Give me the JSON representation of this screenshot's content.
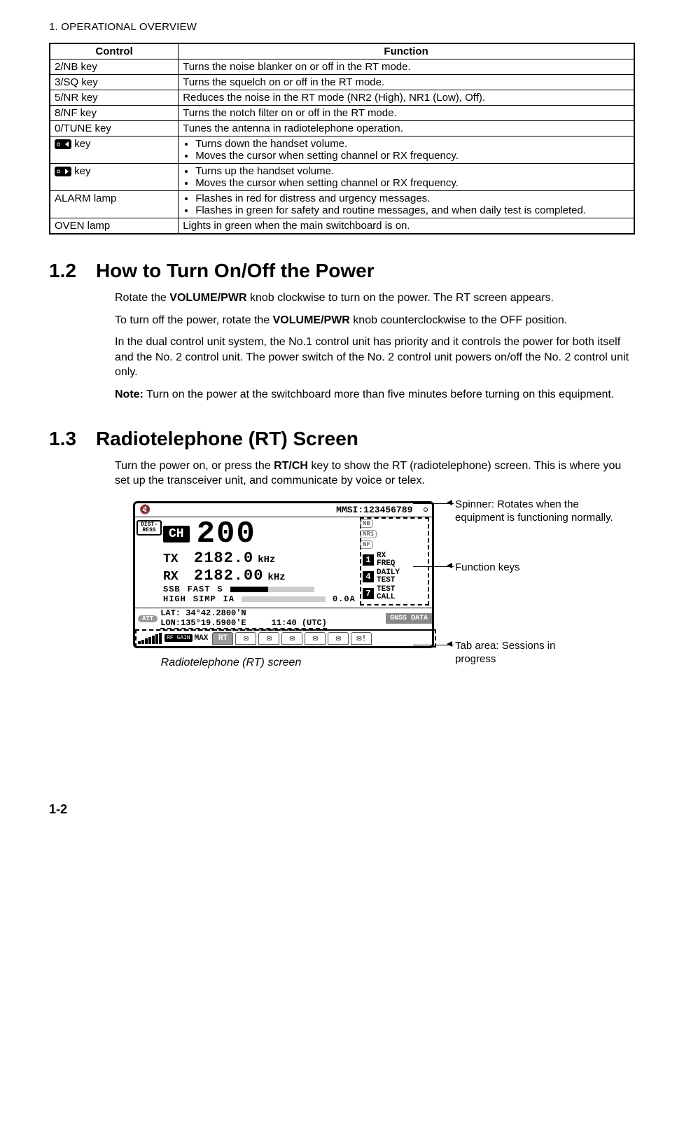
{
  "page_header": "1.  OPERATIONAL OVERVIEW",
  "page_number": "1-2",
  "table": {
    "head": {
      "control": "Control",
      "function": "Function"
    },
    "rows": [
      {
        "control": "2/NB key",
        "function": "Turns the noise blanker on or off in the RT mode."
      },
      {
        "control": "3/SQ key",
        "function": "Turns the squelch on or off in the RT mode."
      },
      {
        "control": "5/NR key",
        "function": "Reduces the noise in the RT mode (NR2 (High), NR1 (Low), Off)."
      },
      {
        "control": "8/NF key",
        "function": "Turns the notch filter on or off in the RT mode."
      },
      {
        "control": "0/TUNE key",
        "function": "Tunes the antenna in radiotelephone operation."
      }
    ],
    "vol_down": {
      "control_suffix": " key",
      "bullets": [
        "Turns down the handset volume.",
        "Moves the cursor when setting channel or RX frequency."
      ]
    },
    "vol_up": {
      "control_suffix": " key",
      "bullets": [
        "Turns up the handset volume.",
        "Moves the cursor when setting channel or RX frequency."
      ]
    },
    "alarm": {
      "control": "ALARM lamp",
      "bullets": [
        "Flashes in red for distress and urgency messages.",
        "Flashes in green for safety and routine messages, and when daily test is completed."
      ]
    },
    "oven": {
      "control": "OVEN lamp",
      "function": "Lights in green when the main switchboard is on."
    }
  },
  "section12": {
    "num": "1.2",
    "title": "How to Turn On/Off the Power",
    "p1a": "Rotate the ",
    "p1b": "VOLUME/PWR",
    "p1c": " knob clockwise to turn on the power. The RT screen appears.",
    "p2a": "To turn off the power, rotate the ",
    "p2b": "VOLUME/PWR",
    "p2c": " knob counterclockwise to the OFF position.",
    "p3": "In the dual control unit system, the No.1 control unit has priority and it controls the power for both itself and the No. 2 control unit. The power switch of the No. 2 control unit powers on/off the No. 2 control unit only.",
    "note_label": "Note:",
    "note_body": " Turn on the power at the switchboard more than five minutes before turning on this equipment."
  },
  "section13": {
    "num": "1.3",
    "title": "Radiotelephone (RT) Screen",
    "p1a": "Turn the power on, or press the ",
    "p1b": "RT/CH",
    "p1c": " key to show the RT (radiotelephone) screen. This is where you set up the transceiver unit, and communicate by voice or telex."
  },
  "rt": {
    "mmsi_label": "MMSI:",
    "mmsi_value": "123456789",
    "distress": "DIST-RESS",
    "ch_label": "CH",
    "ch_value": "200",
    "tx_label": "TX",
    "tx_value": "2182.0",
    "tx_unit": "kHz",
    "rx_label": "RX",
    "rx_value": "2182.00",
    "rx_unit": "kHz",
    "mode1": "SSB",
    "mode2": "FAST",
    "s_label": "S",
    "mode3": "HIGH",
    "mode4": "SIMP",
    "ia_label": "IA",
    "ia_val": "0.0A",
    "ind_nb": "NB",
    "ind_nr": "NR1",
    "ind_nf": "NF",
    "fn": [
      {
        "n": "1",
        "l1": "RX",
        "l2": "FREQ"
      },
      {
        "n": "4",
        "l1": "DAILY",
        "l2": "TEST"
      },
      {
        "n": "7",
        "l1": "TEST",
        "l2": "CALL"
      }
    ],
    "att": "ATT",
    "lat": "LAT: 34°42.2800'N",
    "lon": "LON:135°19.5900'E",
    "gnss": "GNSS DATA",
    "time": "11:40 (UTC)",
    "rfgain": "RF GAIN",
    "max": "MAX",
    "tab_rt": "RT"
  },
  "callouts": {
    "spinner": "Spinner: Rotates when the equipment is functioning normally.",
    "fnkeys": "Function keys",
    "tabs": "Tab area: Sessions in progress"
  },
  "caption": "Radiotelephone (RT) screen"
}
